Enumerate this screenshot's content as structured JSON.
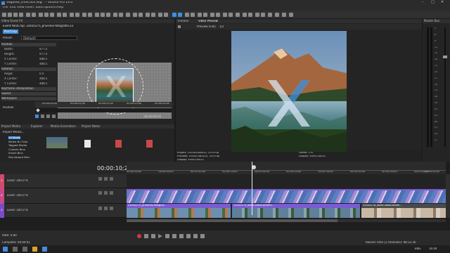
{
  "window": {
    "title": "Vegasex_OneClick.veg * - VEGAS Pro 19.0"
  },
  "menu": [
    "File",
    "Edit",
    "View",
    "Insert",
    "Tools",
    "Options",
    "Help"
  ],
  "fx_panel": {
    "title": "Video Event FX",
    "fx_chain_label": "Event Pan/Crop: 33435275_priveiros-fotografia-23",
    "tab": "Pan/Crop",
    "preset_label": "Preset:",
    "preset_value": "[Default]",
    "properties": [
      {
        "type": "group",
        "label": "Position"
      },
      {
        "type": "prop",
        "label": "Width:",
        "value": "977.0"
      },
      {
        "type": "prop",
        "label": "Height:",
        "value": "977.0"
      },
      {
        "type": "prop",
        "label": "X Center:",
        "value": "488.5"
      },
      {
        "type": "prop",
        "label": "Y Center:",
        "value": "488.5"
      },
      {
        "type": "group",
        "label": "Rotation"
      },
      {
        "type": "prop",
        "label": "Angle:",
        "value": "0.0"
      },
      {
        "type": "prop",
        "label": "X Center:",
        "value": "488.5"
      },
      {
        "type": "prop",
        "label": "Y Center:",
        "value": "488.5"
      },
      {
        "type": "group",
        "label": "Keyframe interpolation"
      },
      {
        "type": "group",
        "label": "Source"
      },
      {
        "type": "group",
        "label": "Workspace"
      }
    ],
    "position_label": "Position",
    "ruler_marks": [
      "00:00:00;00",
      "00:00:01;00",
      "00:00:02;00",
      "00:00:03;00",
      "00:00:04;00"
    ],
    "timecode": "00:00:00;00"
  },
  "preview": {
    "tabs": [
      "Trimmer",
      "Video Preview"
    ],
    "quality": "Preview (Full)",
    "zoom": "1/2",
    "info_left": [
      "Project: 1920x1080x32, 29.970p",
      "Preview: 1920x1080x32, 29.970p",
      "Display: 409x230x32"
    ],
    "info_right": [
      "Frame: 270",
      "Display: 409x230x32"
    ]
  },
  "master": {
    "title": "Master Bus",
    "scale": [
      "-3",
      "-6",
      "-9",
      "-12",
      "-15",
      "-18",
      "-21",
      "-24",
      "-27",
      "-30",
      "-33",
      "-36",
      "-39",
      "-42",
      "-45",
      "-48",
      "-51",
      "-54",
      "-57"
    ]
  },
  "media": {
    "tabs": [
      "Project Media",
      "Explorer",
      "Media Generators",
      "Project Notes"
    ],
    "toolbar": "Import Media...",
    "tree": [
      "All Media",
      "Media By Type",
      "Tagged Media",
      "Custom Bins",
      "Smart Bins",
      "Storyboard Bins"
    ]
  },
  "timeline": {
    "timecode": "00:00:10;20",
    "ruler": [
      "00:00:00;00",
      "00:00:05;00",
      "00:00:10;00",
      "00:00:15;00",
      "00:00:20;00",
      "00:00:25;00",
      "00:00:30;00",
      "00:00:35;00",
      "00:00:40;00",
      "00:00:45;00",
      "00:00:50;00"
    ],
    "tracks": [
      {
        "num": "1",
        "level": "Level: 100.0 %",
        "color": "#d04a6a"
      },
      {
        "num": "2",
        "level": "Level: 100.0 %",
        "color": "#c94a8a"
      },
      {
        "num": "3",
        "level": "Level: 100.0 %",
        "color": "#7b4ac9"
      }
    ],
    "clips": [
      "33435275_priveiros-fotograf...",
      "33435274_stock-video-ameris...",
      "33435278_stock-video-ameri..."
    ]
  },
  "status": {
    "rate": "Rate: 0.00",
    "complete": "Complete: 00:00:01",
    "record_time": "Record Time (2 channels): 98:12:30"
  },
  "taskbar": {
    "lang": "ENG",
    "time": "16:04"
  },
  "colors": {
    "accent": "#3d8edf",
    "clip_purple": "#7a5bd1",
    "record": "#d23a3a"
  }
}
